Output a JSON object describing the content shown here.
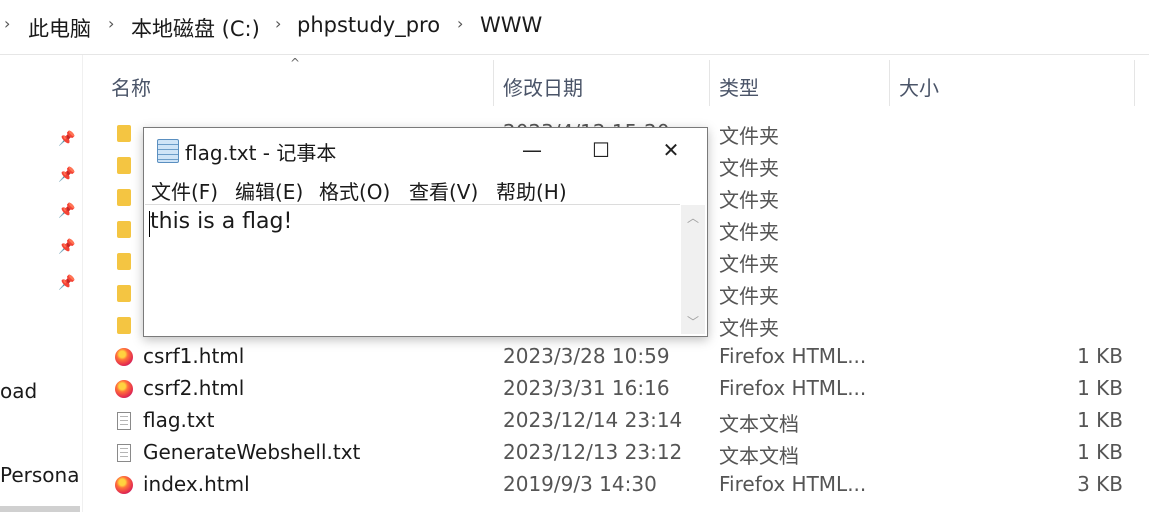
{
  "breadcrumb": {
    "items": [
      "此电脑",
      "本地磁盘 (C:)",
      "phpstudy_pro",
      "WWW"
    ]
  },
  "nav": {
    "labels": [
      "oad",
      "Persona"
    ]
  },
  "columns": {
    "name": "名称",
    "date": "修改日期",
    "type": "类型",
    "size": "大小"
  },
  "folder_rows": [
    {
      "name": "",
      "date": "2023/4/12 15:20",
      "type": "文件夹"
    },
    {
      "name": "",
      "date": "",
      "type": "文件夹"
    },
    {
      "name": "",
      "date": "",
      "type": "文件夹"
    },
    {
      "name": "",
      "date": "",
      "type": "文件夹"
    },
    {
      "name": "",
      "date": "",
      "type": "文件夹"
    },
    {
      "name": "",
      "date": "",
      "type": "文件夹"
    },
    {
      "name": "",
      "date": "",
      "type": "文件夹"
    }
  ],
  "file_rows": [
    {
      "name": "csrf1.html",
      "date": "2023/3/28 10:59",
      "type": "Firefox HTML...",
      "size": "1 KB",
      "icon": "firefox-html-icon"
    },
    {
      "name": "csrf2.html",
      "date": "2023/3/31 16:16",
      "type": "Firefox HTML...",
      "size": "1 KB",
      "icon": "firefox-html-icon"
    },
    {
      "name": "flag.txt",
      "date": "2023/12/14 23:14",
      "type": "文本文档",
      "size": "1 KB",
      "icon": "text-file-icon"
    },
    {
      "name": "GenerateWebshell.txt",
      "date": "2023/12/13 23:12",
      "type": "文本文档",
      "size": "1 KB",
      "icon": "text-file-icon"
    },
    {
      "name": "index.html",
      "date": "2019/9/3 14:30",
      "type": "Firefox HTML...",
      "size": "3 KB",
      "icon": "firefox-html-icon"
    }
  ],
  "notepad": {
    "title": "flag.txt - 记事本",
    "menu": [
      "文件(F)",
      "编辑(E)",
      "格式(O)",
      "查看(V)",
      "帮助(H)"
    ],
    "content": "this is a flag!",
    "minimize": "—",
    "maximize": "☐",
    "close": "✕"
  }
}
